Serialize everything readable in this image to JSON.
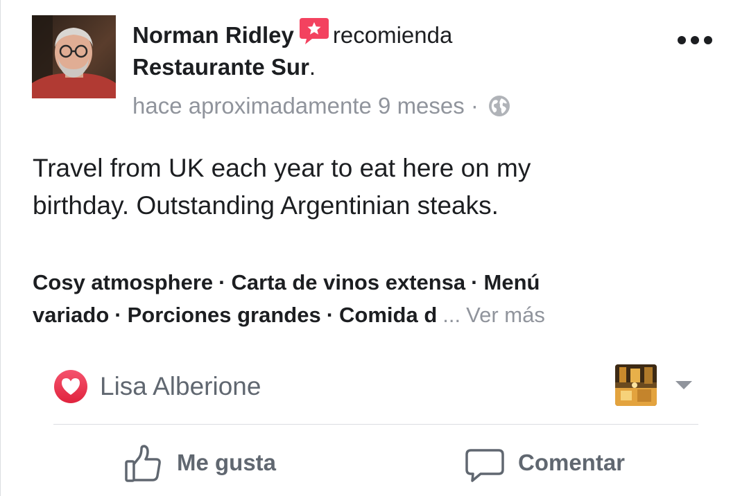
{
  "post": {
    "author": "Norman Ridley",
    "verb": "recomienda",
    "page": "Restaurante Sur",
    "page_suffix": ".",
    "time": "hace aproximadamente 9 meses",
    "time_sep": " · ",
    "body_lines": [
      "Travel from UK each year to eat here on my",
      "birthday. Outstanding Argentinian steaks."
    ],
    "tags": [
      "Cosy atmosphere",
      "Carta de vinos extensa",
      "Menú variado",
      "Porciones grandes",
      "Comida d"
    ],
    "tag_separator": "·",
    "ellipsis": "...",
    "see_more": "Ver más"
  },
  "reactions": {
    "reactor": "Lisa Alberione"
  },
  "actions": {
    "like_label": "Me gusta",
    "comment_label": "Comentar"
  },
  "icons": {
    "recommend_badge": "recommend-star-icon",
    "privacy": "globe-icon",
    "menu": "more-options-icon",
    "love": "love-reaction-icon",
    "dropdown": "caret-down-icon",
    "like": "thumbs-up-icon",
    "comment": "speech-bubble-icon"
  },
  "colors": {
    "text_primary": "#1c1e21",
    "text_secondary": "#90949c",
    "action_text": "#606770",
    "recommend_red": "#f3425f",
    "divider": "#dadde1"
  }
}
